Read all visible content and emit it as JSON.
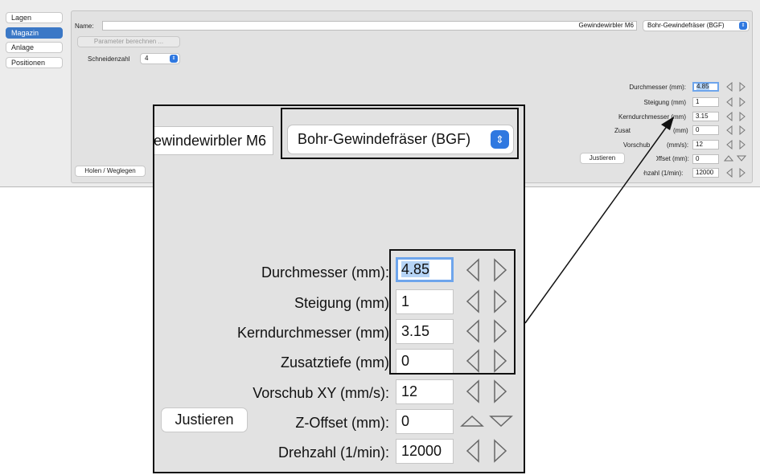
{
  "sidebar": {
    "items": [
      {
        "label": "Lagen",
        "active": false
      },
      {
        "label": "Magazin",
        "active": true
      },
      {
        "label": "Anlage",
        "active": false
      },
      {
        "label": "Positionen",
        "active": false
      }
    ]
  },
  "panel": {
    "name_label": "Name:",
    "name_value": "Gewindewirbler M6",
    "tool_type_value": "Bohr-Gewindefräser (BGF)",
    "compute_button": "Parameter berechnen ...",
    "cutting_edges_label": "Schneidenzahl",
    "cutting_edges_value": "4",
    "fetch_button": "Holen / Weglegen",
    "adjust_button": "Justieren",
    "params": [
      {
        "label": "Durchmesser (mm):",
        "value": "4.85"
      },
      {
        "label": "Steigung (mm)",
        "value": "1"
      },
      {
        "label": "Kerndurchmesser (mm)",
        "value": "3.15"
      },
      {
        "label": "Zusatztiefe (mm)",
        "value": "0"
      },
      {
        "label": "Vorschub XY (mm/s):",
        "value": "12"
      },
      {
        "label": "Z-Offset (mm):",
        "value": "0"
      },
      {
        "label": "Drehzahl (1/min):",
        "value": "12000"
      }
    ],
    "partial_labels": {
      "zusatztiefe": "Zusat",
      "zusatztiefe_tail": "(mm)",
      "vorschub": "Vorschub",
      "vorschub_tail": "(mm/s):",
      "zoffset": "Z-Offset (mm):",
      "drehzahl": "Drehzahl (1/min):"
    }
  },
  "zoom": {
    "name_partial": "ewindewirbler M6",
    "tool_type_value": "Bohr-Gewindefräser (BGF)",
    "adjust_button": "Justieren"
  },
  "colors": {
    "accent": "#3b78c6",
    "select_stepper": "#2f78e0",
    "focus_ring": "#6ea5ec",
    "selection": "#b6d4f6"
  }
}
